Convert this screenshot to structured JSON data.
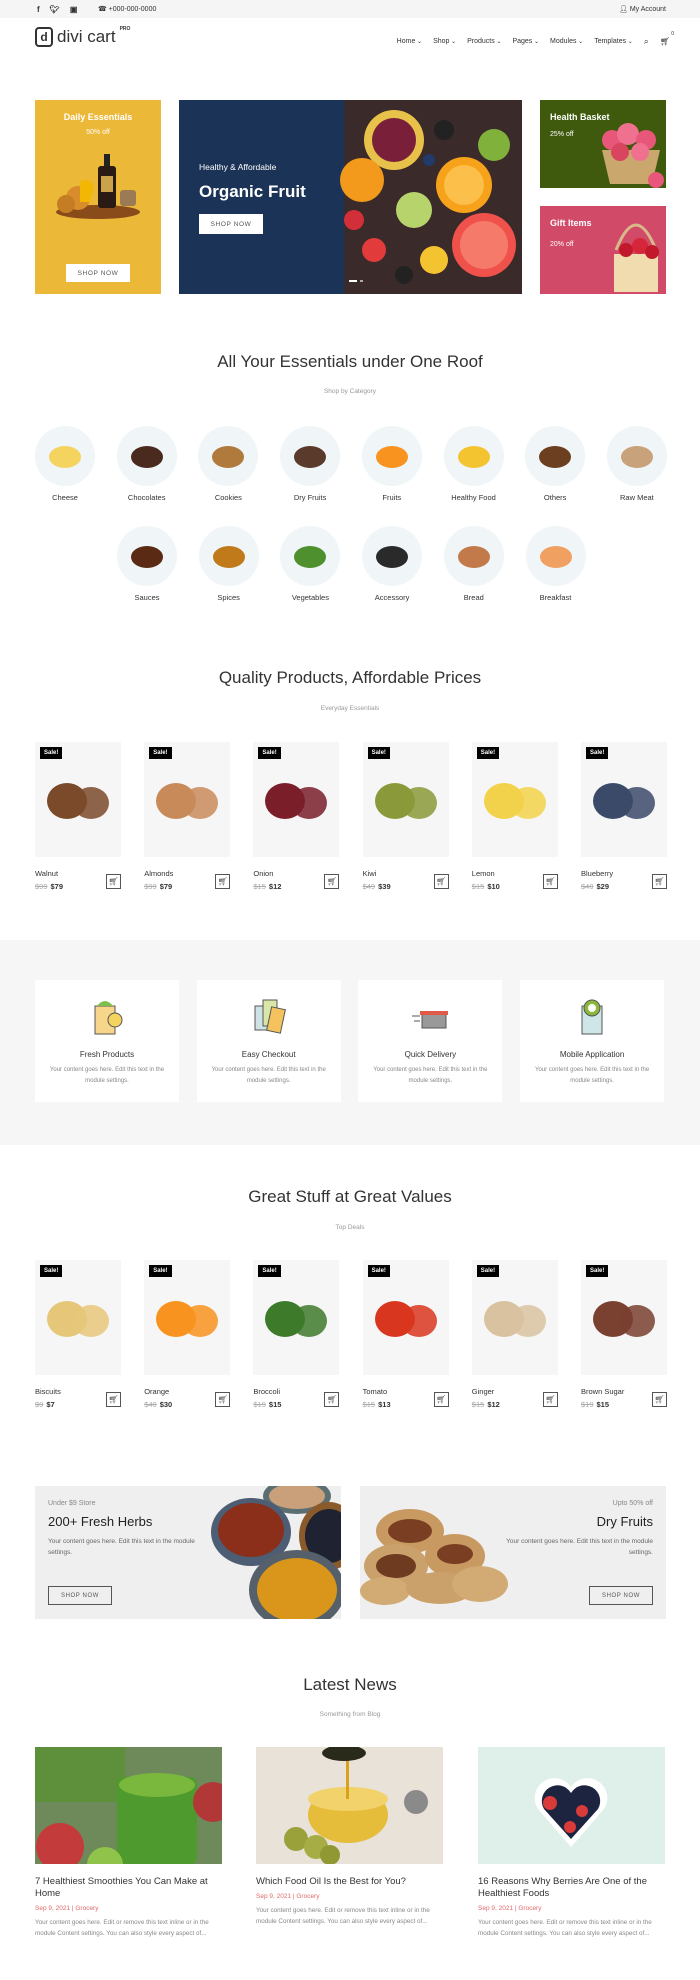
{
  "topbar": {
    "social": [
      "f",
      "t",
      "ig"
    ],
    "phone": "+000-000-0000",
    "account": "My Account"
  },
  "header": {
    "logo_text": "divi cart",
    "logo_badge": "PRO",
    "nav": [
      "Home",
      "Shop",
      "Products",
      "Pages",
      "Modules",
      "Templates"
    ],
    "cart_count": "0"
  },
  "hero": {
    "left": {
      "title": "Daily Essentials",
      "offer": "50% off",
      "button": "SHOP NOW",
      "bg": "#ecb838"
    },
    "main": {
      "kicker": "Healthy & Affordable",
      "title": "Organic Fruit",
      "button": "SHOP NOW",
      "bg": "#1b3356"
    },
    "right_top": {
      "title": "Health Basket",
      "offer": "25% off",
      "bg": "#3f5a0d"
    },
    "right_bottom": {
      "title": "Gift Items",
      "offer": "20% off",
      "bg": "#d14a68"
    }
  },
  "categories": {
    "title": "All Your Essentials under One Roof",
    "subtitle": "Shop by Category",
    "items": [
      "Cheese",
      "Chocolates",
      "Cookies",
      "Dry Fruits",
      "Fruits",
      "Healthy Food",
      "Others",
      "Raw Meat",
      "Sauces",
      "Spices",
      "Vegetables",
      "Accessory",
      "Bread",
      "Breakfast"
    ]
  },
  "quality": {
    "title": "Quality Products, Affordable Prices",
    "subtitle": "Everyday Essentials",
    "sale_label": "Sale!",
    "products": [
      {
        "name": "Walnut",
        "old": "$99",
        "new": "$79"
      },
      {
        "name": "Almonds",
        "old": "$99",
        "new": "$79"
      },
      {
        "name": "Onion",
        "old": "$15",
        "new": "$12"
      },
      {
        "name": "Kiwi",
        "old": "$49",
        "new": "$39"
      },
      {
        "name": "Lemon",
        "old": "$15",
        "new": "$10"
      },
      {
        "name": "Blueberry",
        "old": "$40",
        "new": "$29"
      }
    ]
  },
  "features": [
    {
      "title": "Fresh Products",
      "text": "Your content goes here. Edit this text in the module settings."
    },
    {
      "title": "Easy Checkout",
      "text": "Your content goes here. Edit this text in the module settings."
    },
    {
      "title": "Quick Delivery",
      "text": "Your content goes here. Edit this text in the module settings."
    },
    {
      "title": "Mobile Application",
      "text": "Your content goes here. Edit this text in the module settings."
    }
  ],
  "great": {
    "title": "Great Stuff at Great Values",
    "subtitle": "Top Deals",
    "sale_label": "Sale!",
    "products": [
      {
        "name": "Biscuits",
        "old": "$9",
        "new": "$7"
      },
      {
        "name": "Orange",
        "old": "$40",
        "new": "$30"
      },
      {
        "name": "Broccoli",
        "old": "$19",
        "new": "$15"
      },
      {
        "name": "Tomato",
        "old": "$15",
        "new": "$13"
      },
      {
        "name": "Ginger",
        "old": "$15",
        "new": "$12"
      },
      {
        "name": "Brown Sugar",
        "old": "$19",
        "new": "$15"
      }
    ]
  },
  "promos": [
    {
      "kicker": "Under $9 Store",
      "title": "200+ Fresh Herbs",
      "text": "Your content goes here. Edit this text in the module settings.",
      "button": "SHOP NOW"
    },
    {
      "kicker": "Upto 50% off",
      "title": "Dry Fruits",
      "text": "Your content goes here. Edit this text in the module settings.",
      "button": "SHOP NOW"
    }
  ],
  "news": {
    "title": "Latest News",
    "subtitle": "Something from Blog",
    "posts": [
      {
        "title": "7 Healthiest Smoothies You Can Make at Home",
        "meta": "Sep 9, 2021 | Grocery",
        "excerpt": "Your content goes here. Edit or remove this text inline or in the module Content settings. You can also style every aspect of..."
      },
      {
        "title": "Which Food Oil Is the Best for You?",
        "meta": "Sep 9, 2021 | Grocery",
        "excerpt": "Your content goes here. Edit or remove this text inline or in the module Content settings. You can also style every aspect of..."
      },
      {
        "title": "16 Reasons Why Berries Are One of the Healthiest Foods",
        "meta": "Sep 9, 2021 | Grocery",
        "excerpt": "Your content goes here. Edit or remove this text inline or in the module Content settings. You can also style every aspect of..."
      }
    ]
  }
}
